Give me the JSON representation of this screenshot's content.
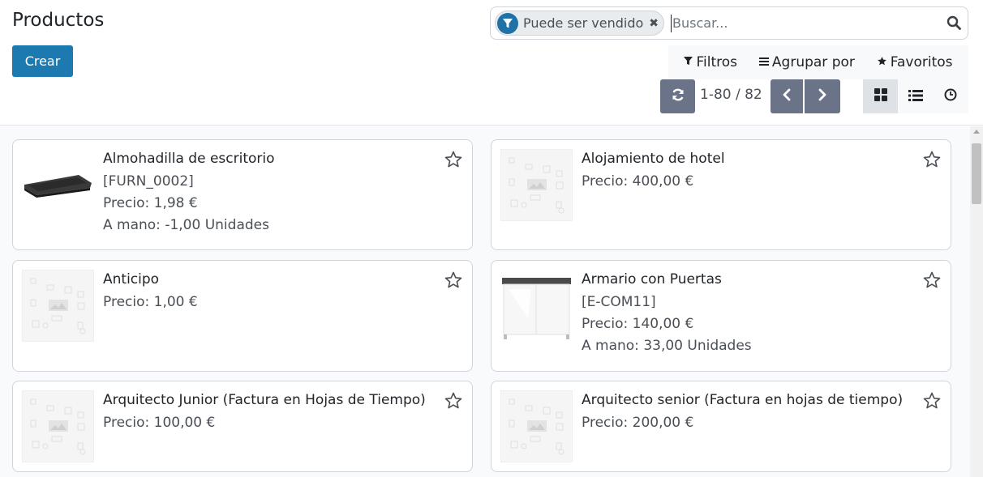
{
  "header": {
    "title": "Productos",
    "create_label": "Crear"
  },
  "search": {
    "facet_label": "Puede ser vendido",
    "placeholder": "Buscar..."
  },
  "filters": {
    "filters_label": "Filtros",
    "group_label": "Agrupar por",
    "favorites_label": "Favoritos"
  },
  "pager": {
    "value": "1-80 / 82"
  },
  "products": [
    {
      "name": "Almohadilla de escritorio",
      "ref": "[FURN_0002]",
      "price": "Precio: 1,98 €",
      "onhand": "A mano: -1,00 Unidades",
      "image": "desk-pad"
    },
    {
      "name": "Alojamiento de hotel",
      "ref": "",
      "price": "Precio: 400,00 €",
      "onhand": "",
      "image": "placeholder"
    },
    {
      "name": "Anticipo",
      "ref": "",
      "price": "Precio: 1,00 €",
      "onhand": "",
      "image": "placeholder"
    },
    {
      "name": "Armario con Puertas",
      "ref": "[E-COM11]",
      "price": "Precio: 140,00 €",
      "onhand": "A mano: 33,00 Unidades",
      "image": "cabinet"
    },
    {
      "name": "Arquitecto Junior (Factura en Hojas de Tiempo)",
      "ref": "",
      "price": "Precio: 100,00 €",
      "onhand": "",
      "image": "placeholder"
    },
    {
      "name": "Arquitecto senior (Factura en hojas de tiempo)",
      "ref": "",
      "price": "Precio: 200,00 €",
      "onhand": "",
      "image": "placeholder"
    }
  ]
}
